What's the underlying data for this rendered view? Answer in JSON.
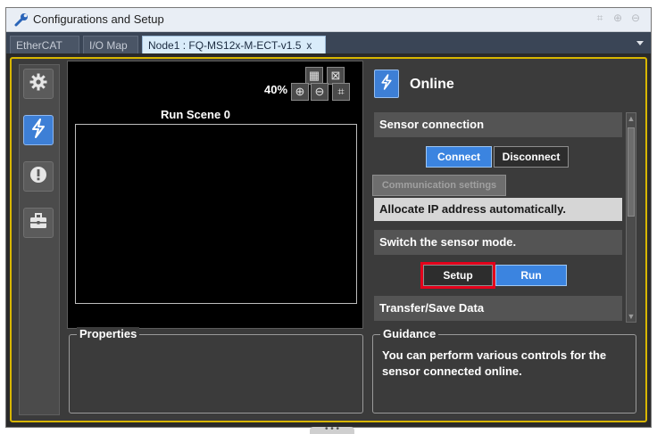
{
  "window": {
    "title": "Configurations and Setup",
    "title_icons": [
      "fit-window-icon",
      "zoom-in-icon",
      "zoom-out-icon"
    ]
  },
  "tabs": [
    {
      "label": "EtherCAT",
      "active": false
    },
    {
      "label": "I/O Map",
      "active": false
    },
    {
      "label": "Node1 : FQ-MS12x-M-ECT-v1.5",
      "active": true,
      "close": "x"
    }
  ],
  "left_toolbar": {
    "items": [
      "gear-icon",
      "lightning-icon",
      "warning-icon",
      "toolbox-icon"
    ],
    "active_index": 1
  },
  "image_view": {
    "zoom_label": "40%",
    "scene_label": "Run Scene 0",
    "tool_icons": [
      "grid-icon",
      "select-icon",
      "zoom-in-icon",
      "zoom-out-icon",
      "fit-icon"
    ]
  },
  "properties": {
    "label": "Properties"
  },
  "online_panel": {
    "title": "Online",
    "sensor_connection": {
      "header": "Sensor connection",
      "connect_label": "Connect",
      "disconnect_label": "Disconnect",
      "comm_settings_label": "Communication settings",
      "allocate_ip_label": "Allocate IP address automatically."
    },
    "sensor_mode": {
      "header": "Switch the sensor mode.",
      "setup_label": "Setup",
      "run_label": "Run",
      "highlighted": "Setup"
    },
    "transfer": {
      "header": "Transfer/Save Data"
    }
  },
  "guidance": {
    "label": "Guidance",
    "text": "You can perform various controls for the sensor connected online."
  },
  "colors": {
    "accent_blue": "#3b84e0",
    "frame_yellow": "#d8b600",
    "highlight_red": "#e4001b",
    "panel_bg": "#3b3b3b"
  },
  "bottom_grip": "• • •"
}
